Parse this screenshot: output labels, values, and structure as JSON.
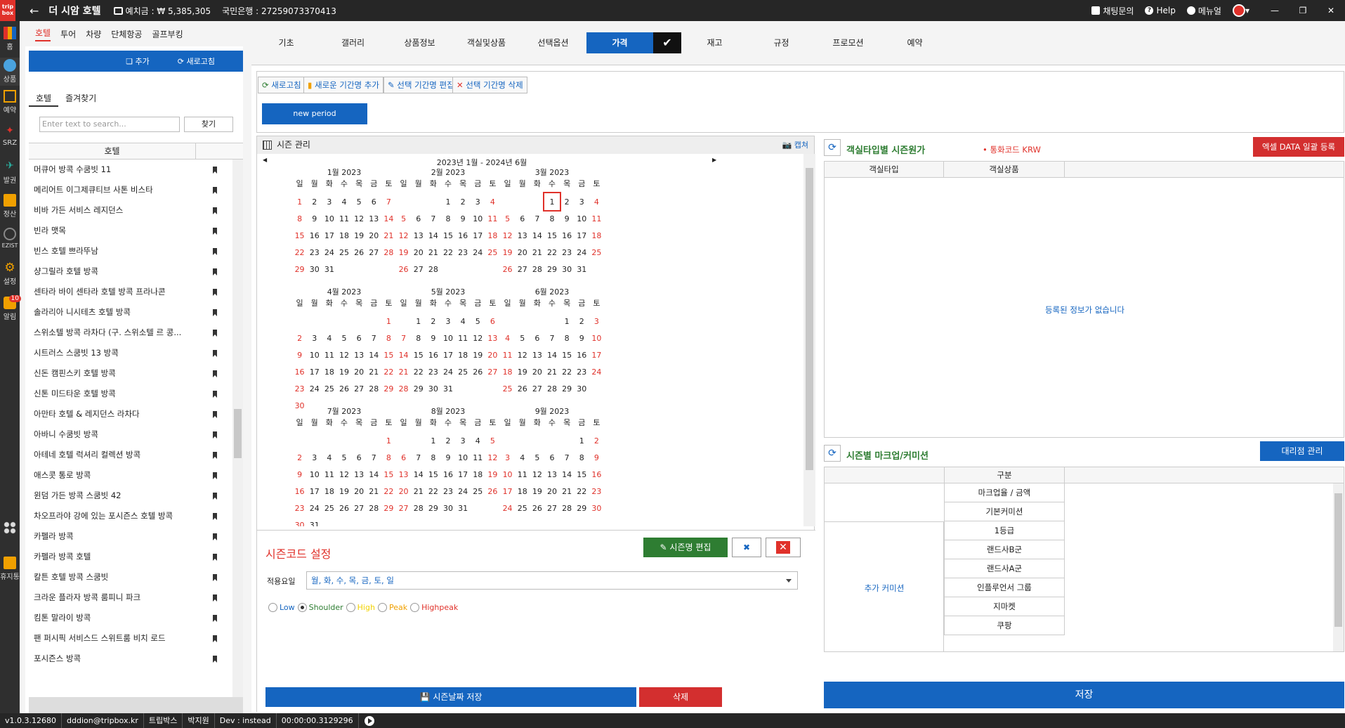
{
  "topbar": {
    "logo": "trip box",
    "hotel_title": "더 시암 호텔",
    "deposit": "예치금 : ₩ 5,385,305",
    "bank": "국민은행 : 27259073370413",
    "chat": "채팅문의",
    "help": "Help",
    "manual": "메뉴얼"
  },
  "sidebar": [
    {
      "label": "홈",
      "icon": "chart-icon"
    },
    {
      "label": "상품",
      "icon": "globe-icon"
    },
    {
      "label": "예약",
      "icon": "calendar-icon"
    },
    {
      "label": "SRZ",
      "icon": "share-icon"
    },
    {
      "label": "발권",
      "icon": "plane-icon"
    },
    {
      "label": "정산",
      "icon": "wallet-icon"
    },
    {
      "label": "EZIST",
      "icon": "globe-icon"
    },
    {
      "label": "설정",
      "icon": "gear-icon"
    },
    {
      "label": "알림",
      "icon": "bell-icon",
      "badge": "10"
    },
    {
      "label": "휴지통",
      "icon": "trash-icon"
    }
  ],
  "category_tabs": [
    "호텔",
    "투어",
    "차량",
    "단체항공",
    "골프부킹"
  ],
  "bluebar": {
    "add": "추가",
    "refresh": "새로고침"
  },
  "sub_tabs": [
    "호텔",
    "즐겨찾기"
  ],
  "search": {
    "placeholder": "Enter text to search...",
    "button": "찾기"
  },
  "list_header": "호텔",
  "hotels": [
    "머큐어 방콕 수쿰빗 11",
    "메리어트 이그제큐티브 사톤 비스타",
    "비바 가든 서비스 레지던스",
    "빈라 맷목",
    "빈스 호텔 쁘라뚜남",
    "샹그릴라 호텔 방콕",
    "센타라 바이 센타라 호텔 방콕 프라나콘",
    "솔라리아 니시테츠 호텔 방콕",
    "스위소텔 방콕 라차다 (구. 스위소텔 르 콩...",
    "시트러스 스쿰빗 13 방콕",
    "신돈 캠핀스키 호텔 방콕",
    "신톤 미드타운 호텔 방콕",
    "아만타 호텔 & 레지던스 라차다",
    "아바니 수쿰빗 방콕",
    "아테네 호텔 럭셔리 컬렉션 방콕",
    "애스콧 통로 방콕",
    "윈덤 가든 방콕 스쿰빗 42",
    "차오프라야 강에 있는 포시즌스 호텔 방콕",
    "카펠라 방콕",
    "카펠라 방콕 호텔",
    "칼튼 호텔 방콕 스쿰빗",
    "크라운 플라자 방콕 룸피니 파크",
    "킴톤 말라이 방콕",
    "팬 퍼시픽 서비스드 스위트룸 비치 로드",
    "포시즌스 방콕"
  ],
  "main_tabs": [
    "기초",
    "갤러리",
    "상품정보",
    "객실및상품",
    "선택옵션",
    "가격",
    "재고",
    "규정",
    "프로모션",
    "예약"
  ],
  "active_tab": "가격",
  "toolbar": [
    "새로고침",
    "새로운 기간명 추가",
    "선택 기간명 편집",
    "선택 기간명 삭제"
  ],
  "new_period": "new period",
  "season": {
    "title": "시즌 관리",
    "capture": "캡쳐",
    "range": "2023년 1월 - 2024년 6월",
    "dow": [
      "일",
      "월",
      "화",
      "수",
      "목",
      "금",
      "토"
    ],
    "months": [
      {
        "title": "1월 2023",
        "start": 0,
        "days": 31
      },
      {
        "title": "2월 2023",
        "start": 3,
        "days": 28
      },
      {
        "title": "3월 2023",
        "start": 3,
        "days": 31
      },
      {
        "title": "4월 2023",
        "start": 6,
        "days": 30
      },
      {
        "title": "5월 2023",
        "start": 1,
        "days": 31
      },
      {
        "title": "6월 2023",
        "start": 4,
        "days": 30
      },
      {
        "title": "7월 2023",
        "start": 6,
        "days": 31
      },
      {
        "title": "8월 2023",
        "start": 2,
        "days": 31
      },
      {
        "title": "9월 2023",
        "start": 5,
        "days": 30
      }
    ],
    "selected": {
      "month": 2,
      "day": 1
    }
  },
  "season_code": {
    "title": "시즌코드 설정",
    "edit_button": "시즌명 편집",
    "dow_label": "적용요일",
    "dow_value": "월, 화, 수, 목, 금, 토, 일",
    "levels": [
      {
        "label": "Low",
        "color": "#1565c0",
        "checked": false
      },
      {
        "label": "Shoulder",
        "color": "#2e7d32",
        "checked": true
      },
      {
        "label": "High",
        "color": "#f2d200",
        "checked": false
      },
      {
        "label": "Peak",
        "color": "#f0a000",
        "checked": false
      },
      {
        "label": "Highpeak",
        "color": "#e0312a",
        "checked": false
      }
    ],
    "save_button": "시즌날짜 저장",
    "delete_button": "삭제"
  },
  "room_cost": {
    "title": "객실타입별 시즌원가",
    "currency": "• 통화코드   KRW",
    "excel_button": "엑셀 DATA 일괄 등록",
    "columns": [
      "객실타입",
      "객실상품"
    ],
    "empty": "등록된 정보가 없습니다"
  },
  "markup": {
    "title": "시즌별 마크업/커미션",
    "agency_button": "대리점 관리",
    "column": "구분",
    "rows": [
      "마크업율 / 금액",
      "기본커미션",
      "1등급",
      "랜드사B군",
      "랜드사A군",
      "인플루언서 그룹",
      "지마켓",
      "쿠팡"
    ],
    "extra": "추가 커미션"
  },
  "save": "저장",
  "statusbar": [
    "v1.0.3.12680",
    "dddion@tripbox.kr",
    "트립박스",
    "박지원",
    "Dev : instead",
    "00:00:00.3129296"
  ],
  "colors": {
    "accent": "#1565c0",
    "danger": "#e0312a",
    "green": "#2e7d32"
  }
}
